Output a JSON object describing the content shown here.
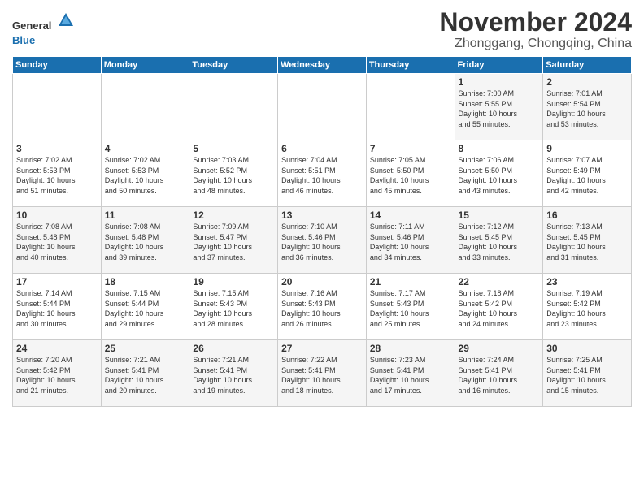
{
  "logo": {
    "general": "General",
    "blue": "Blue"
  },
  "title": "November 2024",
  "subtitle": "Zhonggang, Chongqing, China",
  "days_of_week": [
    "Sunday",
    "Monday",
    "Tuesday",
    "Wednesday",
    "Thursday",
    "Friday",
    "Saturday"
  ],
  "weeks": [
    [
      {
        "day": "",
        "info": ""
      },
      {
        "day": "",
        "info": ""
      },
      {
        "day": "",
        "info": ""
      },
      {
        "day": "",
        "info": ""
      },
      {
        "day": "",
        "info": ""
      },
      {
        "day": "1",
        "info": "Sunrise: 7:00 AM\nSunset: 5:55 PM\nDaylight: 10 hours\nand 55 minutes."
      },
      {
        "day": "2",
        "info": "Sunrise: 7:01 AM\nSunset: 5:54 PM\nDaylight: 10 hours\nand 53 minutes."
      }
    ],
    [
      {
        "day": "3",
        "info": "Sunrise: 7:02 AM\nSunset: 5:53 PM\nDaylight: 10 hours\nand 51 minutes."
      },
      {
        "day": "4",
        "info": "Sunrise: 7:02 AM\nSunset: 5:53 PM\nDaylight: 10 hours\nand 50 minutes."
      },
      {
        "day": "5",
        "info": "Sunrise: 7:03 AM\nSunset: 5:52 PM\nDaylight: 10 hours\nand 48 minutes."
      },
      {
        "day": "6",
        "info": "Sunrise: 7:04 AM\nSunset: 5:51 PM\nDaylight: 10 hours\nand 46 minutes."
      },
      {
        "day": "7",
        "info": "Sunrise: 7:05 AM\nSunset: 5:50 PM\nDaylight: 10 hours\nand 45 minutes."
      },
      {
        "day": "8",
        "info": "Sunrise: 7:06 AM\nSunset: 5:50 PM\nDaylight: 10 hours\nand 43 minutes."
      },
      {
        "day": "9",
        "info": "Sunrise: 7:07 AM\nSunset: 5:49 PM\nDaylight: 10 hours\nand 42 minutes."
      }
    ],
    [
      {
        "day": "10",
        "info": "Sunrise: 7:08 AM\nSunset: 5:48 PM\nDaylight: 10 hours\nand 40 minutes."
      },
      {
        "day": "11",
        "info": "Sunrise: 7:08 AM\nSunset: 5:48 PM\nDaylight: 10 hours\nand 39 minutes."
      },
      {
        "day": "12",
        "info": "Sunrise: 7:09 AM\nSunset: 5:47 PM\nDaylight: 10 hours\nand 37 minutes."
      },
      {
        "day": "13",
        "info": "Sunrise: 7:10 AM\nSunset: 5:46 PM\nDaylight: 10 hours\nand 36 minutes."
      },
      {
        "day": "14",
        "info": "Sunrise: 7:11 AM\nSunset: 5:46 PM\nDaylight: 10 hours\nand 34 minutes."
      },
      {
        "day": "15",
        "info": "Sunrise: 7:12 AM\nSunset: 5:45 PM\nDaylight: 10 hours\nand 33 minutes."
      },
      {
        "day": "16",
        "info": "Sunrise: 7:13 AM\nSunset: 5:45 PM\nDaylight: 10 hours\nand 31 minutes."
      }
    ],
    [
      {
        "day": "17",
        "info": "Sunrise: 7:14 AM\nSunset: 5:44 PM\nDaylight: 10 hours\nand 30 minutes."
      },
      {
        "day": "18",
        "info": "Sunrise: 7:15 AM\nSunset: 5:44 PM\nDaylight: 10 hours\nand 29 minutes."
      },
      {
        "day": "19",
        "info": "Sunrise: 7:15 AM\nSunset: 5:43 PM\nDaylight: 10 hours\nand 28 minutes."
      },
      {
        "day": "20",
        "info": "Sunrise: 7:16 AM\nSunset: 5:43 PM\nDaylight: 10 hours\nand 26 minutes."
      },
      {
        "day": "21",
        "info": "Sunrise: 7:17 AM\nSunset: 5:43 PM\nDaylight: 10 hours\nand 25 minutes."
      },
      {
        "day": "22",
        "info": "Sunrise: 7:18 AM\nSunset: 5:42 PM\nDaylight: 10 hours\nand 24 minutes."
      },
      {
        "day": "23",
        "info": "Sunrise: 7:19 AM\nSunset: 5:42 PM\nDaylight: 10 hours\nand 23 minutes."
      }
    ],
    [
      {
        "day": "24",
        "info": "Sunrise: 7:20 AM\nSunset: 5:42 PM\nDaylight: 10 hours\nand 21 minutes."
      },
      {
        "day": "25",
        "info": "Sunrise: 7:21 AM\nSunset: 5:41 PM\nDaylight: 10 hours\nand 20 minutes."
      },
      {
        "day": "26",
        "info": "Sunrise: 7:21 AM\nSunset: 5:41 PM\nDaylight: 10 hours\nand 19 minutes."
      },
      {
        "day": "27",
        "info": "Sunrise: 7:22 AM\nSunset: 5:41 PM\nDaylight: 10 hours\nand 18 minutes."
      },
      {
        "day": "28",
        "info": "Sunrise: 7:23 AM\nSunset: 5:41 PM\nDaylight: 10 hours\nand 17 minutes."
      },
      {
        "day": "29",
        "info": "Sunrise: 7:24 AM\nSunset: 5:41 PM\nDaylight: 10 hours\nand 16 minutes."
      },
      {
        "day": "30",
        "info": "Sunrise: 7:25 AM\nSunset: 5:41 PM\nDaylight: 10 hours\nand 15 minutes."
      }
    ]
  ]
}
